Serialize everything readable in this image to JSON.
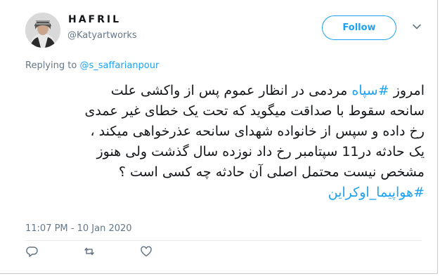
{
  "user": {
    "name": "HAFRIL",
    "handle": "@Katyartworks"
  },
  "follow_label": "Follow",
  "reply": {
    "prefix": "Replying to",
    "target": "@s_saffarianpour"
  },
  "tweet": {
    "line1_start": "امروز ",
    "hashtag1": "#سپاه",
    "line1_rest": " مردمی در انظار عموم پس از واکشی علت",
    "line2": "سانحه سقوط با صداقت میگوید که تحت یک خطای غیر عمدی",
    "line3": "رخ داده و سپس از خانواده شهدای سانحه عذرخواهی میکند ،",
    "line4": "یک حادثه در11 سپتامبر رخ داد نوزده سال گذشت ولی هنوز",
    "line5": "مشخص نیست محتمل اصلی آن حادثه چه کسی است ؟",
    "hashtag2": "#هواپیما_اوکراین"
  },
  "timestamp": "11:07 PM - 10 Jan 2020",
  "actions": [
    "reply-icon",
    "retweet-icon",
    "like-icon"
  ],
  "colors": {
    "accent": "#1da1f2",
    "muted": "#657786",
    "text": "#14171a"
  }
}
